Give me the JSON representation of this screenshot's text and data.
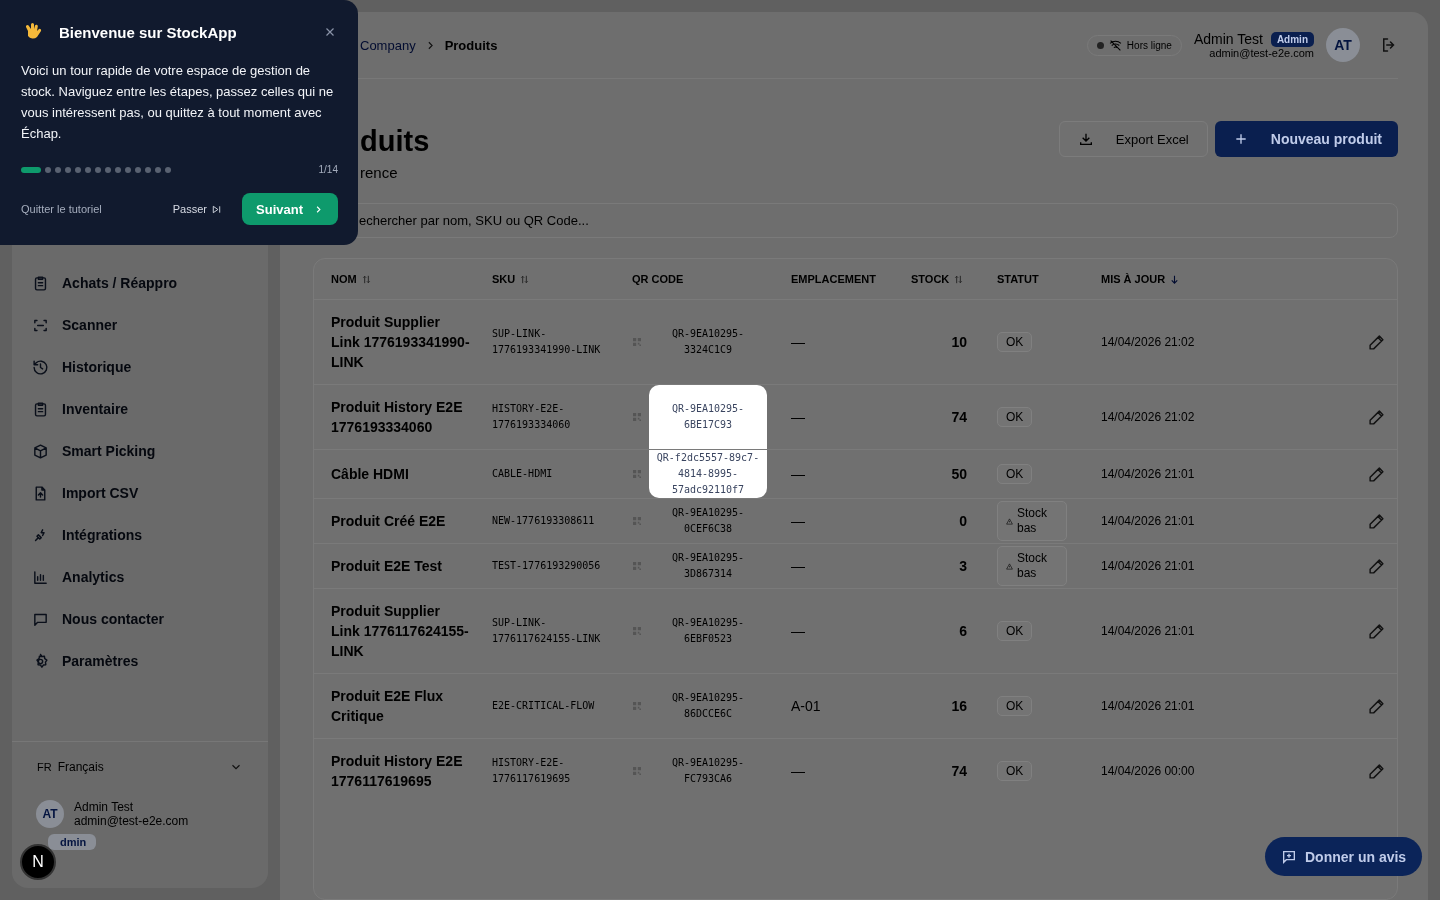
{
  "tour": {
    "title": "Bienvenue sur StockApp",
    "text": "Voici un tour rapide de votre espace de gestion de stock. Naviguez entre les étapes, passez celles qui ne vous intéressent pas, ou quittez à tout moment avec Échap.",
    "steps": [
      {
        "selected": true
      },
      {
        "selected": false
      },
      {
        "selected": false
      },
      {
        "selected": false
      },
      {
        "selected": false
      },
      {
        "selected": false
      },
      {
        "selected": false
      },
      {
        "selected": false
      },
      {
        "selected": false
      },
      {
        "selected": false
      },
      {
        "selected": false
      },
      {
        "selected": false
      },
      {
        "selected": false
      },
      {
        "selected": false
      }
    ],
    "counter": "1/14",
    "quit": "Quitter le tutoriel",
    "skip": "Passer",
    "next": "Suivant"
  },
  "sidebar": {
    "items": [
      {
        "label": "Achats / Réappro"
      },
      {
        "label": "Scanner"
      },
      {
        "label": "Historique"
      },
      {
        "label": "Inventaire"
      },
      {
        "label": "Smart Picking"
      },
      {
        "label": "Import CSV"
      },
      {
        "label": "Intégrations"
      },
      {
        "label": "Analytics"
      },
      {
        "label": "Nous contacter"
      },
      {
        "label": "Paramètres"
      }
    ],
    "language": {
      "code": "FR",
      "label": "Français"
    },
    "user": {
      "initials": "AT",
      "name": "Admin Test",
      "email": "admin@test-e2e.com",
      "role": "dmin"
    }
  },
  "header": {
    "breadcrumb": [
      {
        "label": "Company",
        "kind": "link"
      },
      {
        "label": "Produits",
        "kind": "current"
      }
    ],
    "status": "Hors ligne",
    "user_name": "Admin Test",
    "role": "Admin",
    "email": "admin@test-e2e.com",
    "initials": "AT"
  },
  "page": {
    "title": "duits",
    "subtitle": "rence",
    "export": "Export Excel",
    "new": "Nouveau produit",
    "search": {
      "placeholder": "echercher par nom, SKU ou QR Code..."
    }
  },
  "table": {
    "columns": [
      {
        "label": "NOM",
        "sortable": true,
        "sorted": false
      },
      {
        "label": "SKU",
        "sortable": true,
        "sorted": false
      },
      {
        "label": "QR CODE",
        "sortable": false,
        "sorted": false
      },
      {
        "label": "EMPLACEMENT",
        "sortable": false,
        "sorted": false
      },
      {
        "label": "STOCK",
        "sortable": true,
        "sorted": false
      },
      {
        "label": "STATUT",
        "sortable": false,
        "sorted": false
      },
      {
        "label": "MIS À JOUR",
        "sortable": true,
        "sorted": true
      }
    ],
    "rows": [
      {
        "name": "Produit Supplier Link 1776193341990-LINK",
        "sku": "SUP-LINK-1776193341990-LINK",
        "qr": "QR-9EA10295-3324C1C9",
        "location": "—",
        "stock": "10",
        "status": {
          "kind": "ok",
          "label": "OK"
        },
        "updated": "14/04/2026 21:02",
        "highlighted": false
      },
      {
        "name": "Produit History E2E 1776193334060",
        "sku": "HISTORY-E2E-1776193334060",
        "qr": "QR-9EA10295-6BE17C93",
        "location": "—",
        "stock": "74",
        "status": {
          "kind": "ok",
          "label": "OK"
        },
        "updated": "14/04/2026 21:02",
        "highlighted": true
      },
      {
        "name": "Câble HDMI",
        "sku": "CABLE-HDMI",
        "qr": "QR-f2dc5557-89c7-4814-8995-57adc92110f7",
        "location": "—",
        "stock": "50",
        "status": {
          "kind": "ok",
          "label": "OK"
        },
        "updated": "14/04/2026 21:01",
        "highlighted": true
      },
      {
        "name": "Produit Créé E2E",
        "sku": "NEW-1776193308611",
        "qr": "QR-9EA10295-0CEF6C38",
        "location": "—",
        "stock": "0",
        "status": {
          "kind": "low",
          "label": "Stock bas"
        },
        "updated": "14/04/2026 21:01",
        "highlighted": false
      },
      {
        "name": "Produit E2E Test",
        "sku": "TEST-1776193290056",
        "qr": "QR-9EA10295-3D867314",
        "location": "—",
        "stock": "3",
        "status": {
          "kind": "low",
          "label": "Stock bas"
        },
        "updated": "14/04/2026 21:01",
        "highlighted": false
      },
      {
        "name": "Produit Supplier Link 1776117624155-LINK",
        "sku": "SUP-LINK-1776117624155-LINK",
        "qr": "QR-9EA10295-6EBF0523",
        "location": "—",
        "stock": "6",
        "status": {
          "kind": "ok",
          "label": "OK"
        },
        "updated": "14/04/2026 21:01",
        "highlighted": false
      },
      {
        "name": "Produit E2E Flux Critique",
        "sku": "E2E-CRITICAL-FLOW",
        "qr": "QR-9EA10295-86DCCE6C",
        "location": "A-01",
        "stock": "16",
        "status": {
          "kind": "ok",
          "label": "OK"
        },
        "updated": "14/04/2026 21:01",
        "highlighted": false
      },
      {
        "name": "Produit History E2E 1776117619695",
        "sku": "HISTORY-E2E-1776117619695",
        "qr": "QR-9EA10295-FC793CA6",
        "location": "—",
        "stock": "74",
        "status": {
          "kind": "ok",
          "label": "OK"
        },
        "updated": "14/04/2026 00:00",
        "highlighted": false
      }
    ]
  },
  "feedback": "Donner un avis",
  "dev_badge": "N"
}
